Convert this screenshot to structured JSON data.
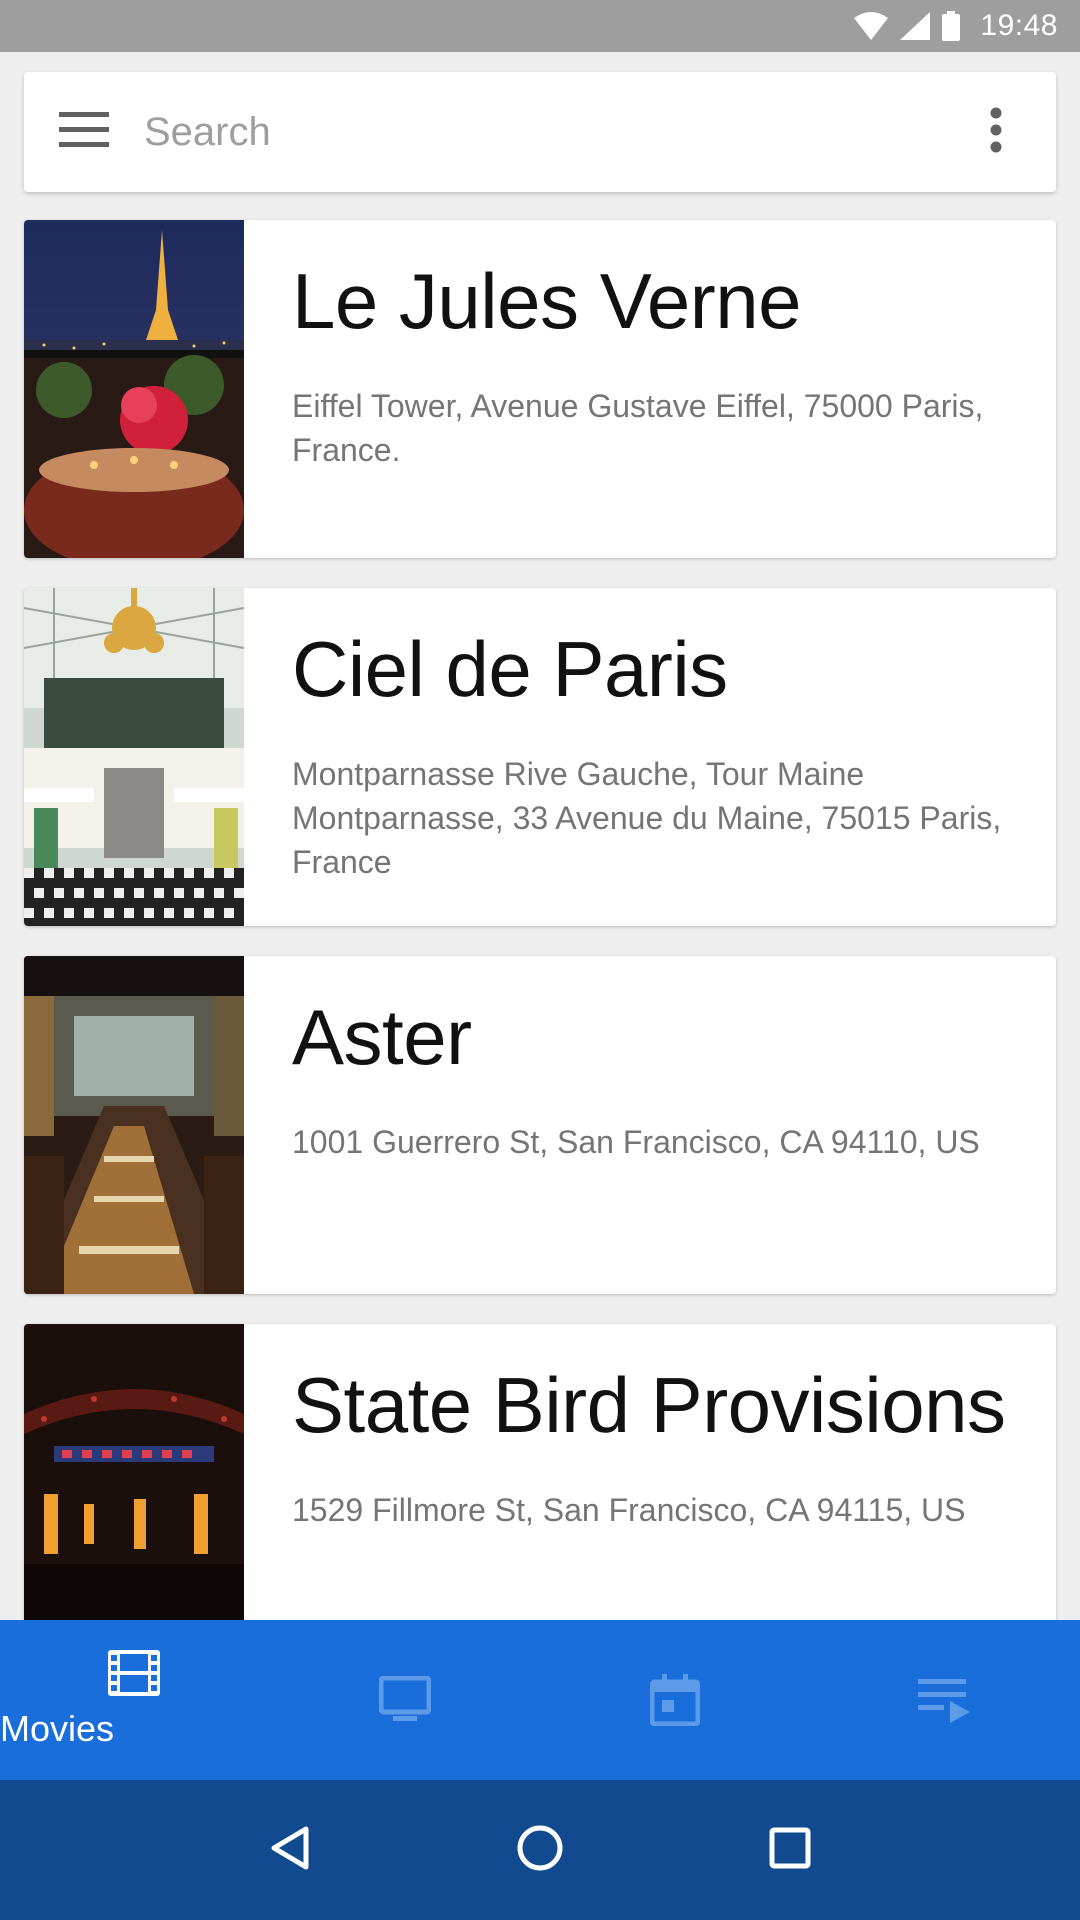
{
  "status_bar": {
    "time": "19:48",
    "icons": [
      "wifi-icon",
      "cell-signal-icon",
      "battery-icon"
    ]
  },
  "search": {
    "placeholder": "Search",
    "value": "",
    "menu_icon": "hamburger-menu-icon",
    "more_icon": "more-vert-icon"
  },
  "restaurants": [
    {
      "name": "Le Jules Verne",
      "address": "Eiffel Tower, Avenue Gustave Eiffel, 75000 Paris, France.",
      "image": "eiffel-tower-dining-photo"
    },
    {
      "name": "Ciel de Paris",
      "address": "Montparnasse Rive Gauche, Tour Maine Montparnasse, 33 Avenue du Maine, 75015 Paris, France",
      "image": "chandelier-dining-room-photo"
    },
    {
      "name": "Aster",
      "address": "1001 Guerrero St, San Francisco, CA 94110, US",
      "image": "restaurant-interior-photo"
    },
    {
      "name": "State Bird Provisions",
      "address": "1529 Fillmore St, San Francisco, CA 94115, US",
      "image": "neon-sign-restaurant-photo"
    }
  ],
  "bottom_nav": {
    "items": [
      {
        "label": "Movies",
        "icon": "movie-film-icon",
        "active": true
      },
      {
        "label": "",
        "icon": "tv-icon",
        "active": false
      },
      {
        "label": "",
        "icon": "calendar-icon",
        "active": false
      },
      {
        "label": "",
        "icon": "playlist-icon",
        "active": false
      }
    ]
  },
  "system_nav": {
    "icons": [
      "back-icon",
      "home-icon",
      "recents-icon"
    ]
  },
  "colors": {
    "status_bar": "#9e9e9e",
    "background": "#eeeeee",
    "bottom_nav": "#1a6edb",
    "system_nav": "#114a8e",
    "inactive_nav_icon": "#5d9be8"
  }
}
